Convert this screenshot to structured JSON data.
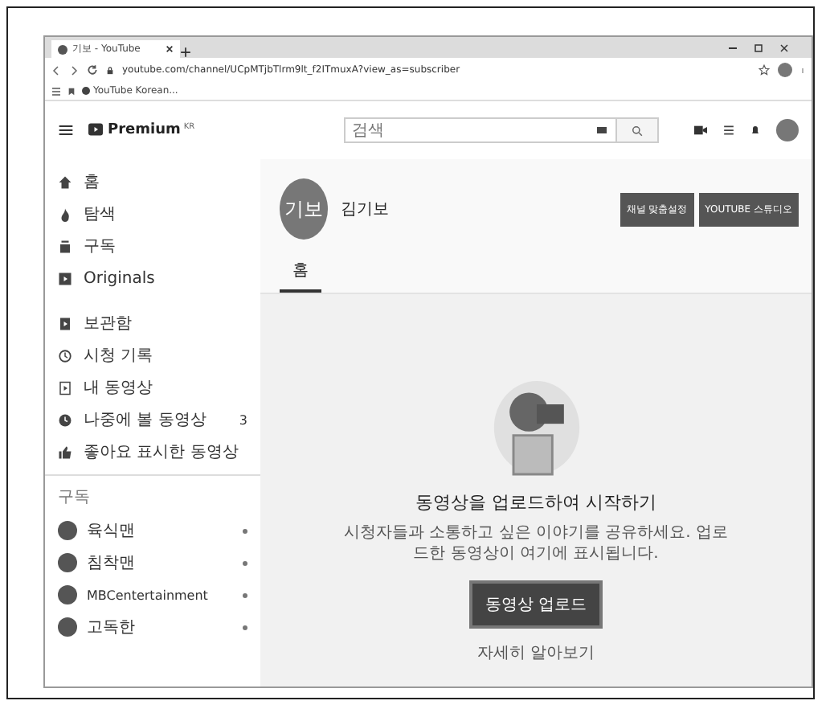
{
  "browser": {
    "tab": {
      "title": "기보 - YouTube",
      "selected": true
    },
    "url": "youtube.com/channel/UCpMTjbTlrm9lt_f2ITmuxA?view_as=subscriber",
    "bookmarks": [
      "YouTube Korean..."
    ]
  },
  "header": {
    "logo_text": "Premium",
    "logo_badge": "KR",
    "search": {
      "placeholder": "검색"
    }
  },
  "sidebar": {
    "items": [
      {
        "label": "홈",
        "selected": false
      },
      {
        "label": "탐색",
        "selected": false
      },
      {
        "label": "구독",
        "selected": false
      },
      {
        "label": "Originals",
        "selected": false
      },
      {
        "label": "보관함",
        "selected": false
      },
      {
        "label": "시청 기록",
        "selected": false
      },
      {
        "label": "내 동영상",
        "selected": false
      },
      {
        "label": "나중에 볼 동영상",
        "selected": false,
        "count": "3"
      },
      {
        "label": "좋아요 표시한 동영상",
        "selected": false
      }
    ],
    "section_title": "구독",
    "subscriptions": [
      {
        "name": "육식맨",
        "new_content": true
      },
      {
        "name": "침착맨",
        "new_content": true
      },
      {
        "name": "MBCentertainment",
        "new_content": true
      },
      {
        "name": "고독한",
        "new_content": true
      }
    ]
  },
  "channel": {
    "avatar_text": "기보",
    "name": "김기보",
    "buttons": [
      "채널 맞춤설정",
      "YOUTUBE 스튜디오"
    ],
    "tabs": [
      {
        "label": "홈",
        "selected": true
      }
    ]
  },
  "empty_state": {
    "title": "동영상을 업로드하여 시작하기",
    "text": "시청자들과 소통하고 싶은 이야기를 공유하세요. 업로드한 동영상이 여기에 표시됩니다.",
    "button": "동영상 업로드",
    "link": "자세히 알아보기"
  }
}
